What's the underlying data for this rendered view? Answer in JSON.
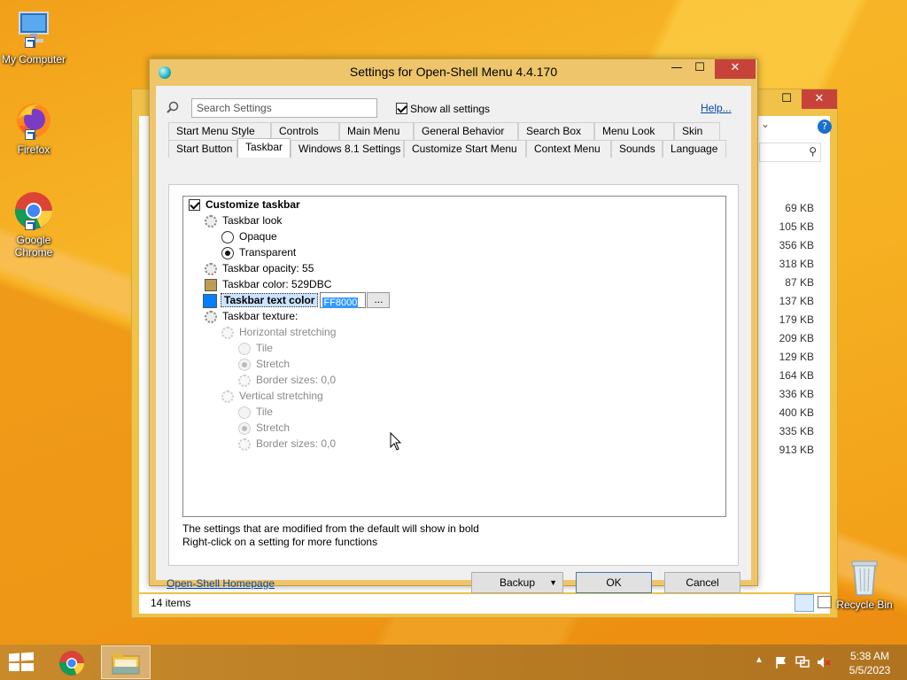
{
  "desktop": {
    "icons": [
      {
        "label": "My Computer",
        "icon": "computer-icon"
      },
      {
        "label": "Firefox",
        "icon": "firefox-icon"
      },
      {
        "label": "Google Chrome",
        "icon": "chrome-icon"
      },
      {
        "label": "Recycle Bin",
        "icon": "recycle-bin-icon"
      }
    ]
  },
  "explorer": {
    "status": "14 items",
    "file_sizes": [
      "69 KB",
      "105 KB",
      "356 KB",
      "318 KB",
      "87 KB",
      "137 KB",
      "179 KB",
      "209 KB",
      "129 KB",
      "164 KB",
      "336 KB",
      "400 KB",
      "335 KB",
      "913 KB"
    ]
  },
  "dialog": {
    "title": "Settings for Open-Shell Menu 4.4.170",
    "search_placeholder": "Search Settings",
    "show_all_label": "Show all settings",
    "show_all_checked": true,
    "help_link": "Help...",
    "tabs_row1": [
      "Start Menu Style",
      "Controls",
      "Main Menu",
      "General Behavior",
      "Search Box",
      "Menu Look",
      "Skin"
    ],
    "tabs_row2": [
      "Start Button",
      "Taskbar",
      "Windows 8.1 Settings",
      "Customize Start Menu",
      "Context Menu",
      "Sounds",
      "Language"
    ],
    "active_tab": "Taskbar",
    "settings": {
      "customize_taskbar": "Customize taskbar",
      "taskbar_look": "Taskbar look",
      "opaque": "Opaque",
      "transparent": "Transparent",
      "opacity": "Taskbar opacity: 55",
      "color": "Taskbar color: 529DBC",
      "color_swatch": "#bc9d52",
      "text_color_label": "Taskbar text color",
      "text_color_value": "FF8000",
      "text_color_swatch": "#0080ff",
      "browse": "...",
      "texture": "Taskbar texture:",
      "horizontal": "Horizontal stretching",
      "tile1": "Tile",
      "stretch1": "Stretch",
      "border1": "Border sizes: 0,0",
      "vertical": "Vertical stretching",
      "tile2": "Tile",
      "stretch2": "Stretch",
      "border2": "Border sizes: 0,0"
    },
    "hint1": "The settings that are modified from the default will show in bold",
    "hint2": "Right-click on a setting for more functions",
    "homepage_link": "Open-Shell Homepage",
    "buttons": {
      "backup": "Backup",
      "ok": "OK",
      "cancel": "Cancel"
    }
  },
  "taskbar": {
    "time": "5:38 AM",
    "date": "5/5/2023"
  }
}
